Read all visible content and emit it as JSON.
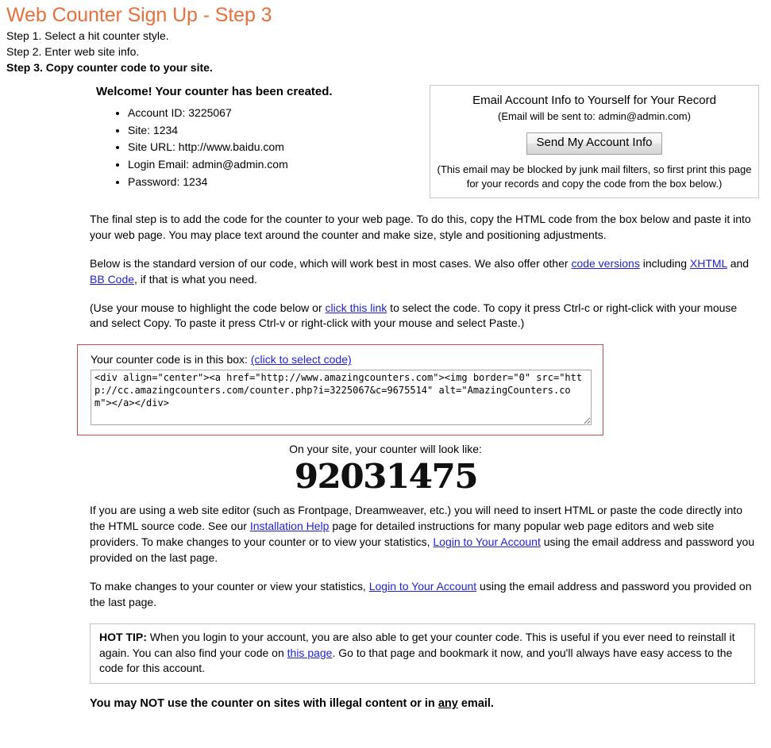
{
  "page": {
    "title": "Web Counter Sign Up - Step 3",
    "title_color": "#e8703c",
    "link_color": "#2222cc",
    "code_box_border_color": "#c0504d"
  },
  "steps": [
    {
      "label": "Step 1. Select a hit counter style.",
      "current": false
    },
    {
      "label": "Step 2. Enter web site info.",
      "current": false
    },
    {
      "label": "Step 3. Copy counter code to your site.",
      "current": true
    }
  ],
  "welcome": {
    "heading": "Welcome! Your counter has been created.",
    "items": [
      "Account ID: 3225067",
      "Site: 1234",
      "Site URL: http://www.baidu.com",
      "Login Email: admin@admin.com",
      "Password: 1234"
    ]
  },
  "email_panel": {
    "title": "Email Account Info to Yourself for Your Record",
    "subtitle": "(Email will be sent to: admin@admin.com)",
    "button_label": "Send My Account Info",
    "note": "(This email may be blocked by junk mail filters, so first print this page for your records and copy the code from the box below.)"
  },
  "paragraphs": {
    "p1": "The final step is to add the code for the counter to your web page. To do this, copy the HTML code from the box below and paste it into your web page. You may place text around the counter and make size, style and positioning adjustments.",
    "p2_a": "Below is the standard version of our code, which will work best in most cases. We also offer other ",
    "p2_link1": "code versions",
    "p2_b": " including ",
    "p2_link2": "XHTML",
    "p2_c": " and ",
    "p2_link3": "BB Code",
    "p2_d": ", if that is what you need.",
    "p3_a": "(Use your mouse to highlight the code below or ",
    "p3_link": "click this link",
    "p3_b": " to select the code. To copy it press Ctrl-c or right-click with your mouse and select Copy. To paste it press Ctrl-v or right-click with your mouse and select Paste.)",
    "p4_a": "If you are using a web site editor (such as Frontpage, Dreamweaver, etc.) you will need to insert HTML or paste the code directly into the HTML source code. See our ",
    "p4_link1": "Installation Help",
    "p4_b": " page for detailed instructions for many popular web page editors and web site providers. To make changes to your counter or to view your statistics, ",
    "p4_link2": "Login to Your Account",
    "p4_c": " using the email address and password you provided on the last page.",
    "p5_a": "To make changes to your counter or view your statistics, ",
    "p5_link": "Login to Your Account",
    "p5_b": " using the email address and password you provided on the last page."
  },
  "code_box": {
    "label": "Your counter code is in this box: ",
    "select_link": "(click to select code)",
    "code": "<div align=\"center\"><a href=\"http://www.amazingcounters.com\"><img border=\"0\" src=\"http://cc.amazingcounters.com/counter.php?i=3225067&c=9675514\" alt=\"AmazingCounters.com\"></a></div>"
  },
  "preview": {
    "caption": "On your site, your counter will look like:",
    "digits": "92031475"
  },
  "hot_tip": {
    "label": "HOT TIP:",
    "text_a": " When you login to your account, you are also able to get your counter code. This is useful if you ever need to reinstall it again. You can also find your code on ",
    "link": "this page",
    "text_b": ". Go to that page and bookmark it now, and you'll always have easy access to the code for this account."
  },
  "footer": {
    "warning_a": "You may NOT use the counter on sites with illegal content or in ",
    "warning_em": "any",
    "warning_b": " email."
  }
}
